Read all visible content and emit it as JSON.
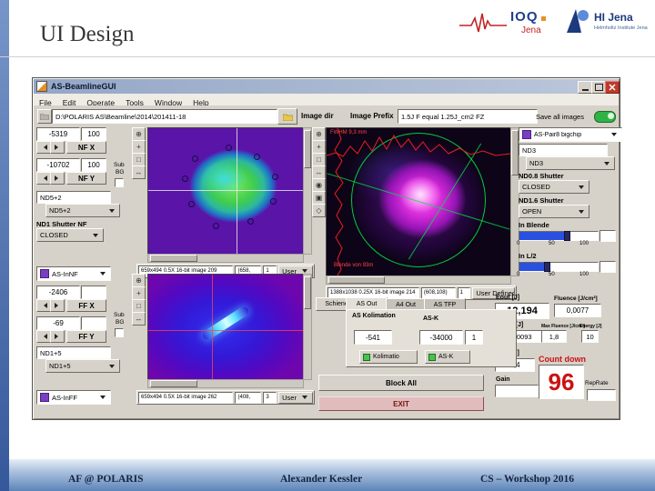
{
  "slide": {
    "title": "UI Design",
    "footer_left": "AF @ POLARIS",
    "footer_center": "Alexander Kessler",
    "footer_right": "CS – Workshop 2016"
  },
  "logos": {
    "ioq_name": "IOQ",
    "ioq_city": "Jena",
    "hi_name": "HI Jena",
    "hi_sub": "Helmholtz Institute Jena"
  },
  "window": {
    "title": "AS-BeamlineGUI",
    "menus": [
      "File",
      "Edit",
      "Operate",
      "Tools",
      "Window",
      "Help"
    ],
    "path_value": "D:\\POLARIS AS\\Beamline\\2014\\201411-18",
    "image_dir_label": "Image dir",
    "image_prefix_label": "Image Prefix",
    "image_prefix_value": "1.5J  F equal 1.25J_cm2 FZ",
    "save_all_label": "Save all images"
  },
  "icons": {
    "tools_small": [
      "⊕",
      "+",
      "□",
      "↔"
    ],
    "tools_big": [
      "⊕",
      "+",
      "□",
      "↔",
      "◉",
      "▣",
      "◇"
    ]
  },
  "nf": {
    "x_value": "-5319",
    "x_step": "100",
    "x_label": "NF X",
    "y_value": "-10702",
    "y_step": "100",
    "y_label": "NF Y",
    "nd_display": "ND5+2",
    "nd_select": "ND5+2",
    "shutter_label": "ND1 Shutter NF",
    "shutter_state": "CLOSED",
    "camera": "AS-InNF",
    "sub_label": "Sub",
    "bg_label": "BG",
    "info": "659x494 0.5X 16-bit image 209",
    "cursor": "(658,",
    "count": "1",
    "user": "User"
  },
  "ff": {
    "x_value": "-2406",
    "x_label": "FF X",
    "y_value": "-69",
    "y_label": "FF Y",
    "nd_display": "ND1+5",
    "nd_select": "ND1+5",
    "camera": "AS-InFF",
    "sub_label": "Sub",
    "bg_label": "BG",
    "info": "659x494 0.5X 16-bit image 262",
    "cursor": "(408,",
    "count": "3",
    "user": "User"
  },
  "big": {
    "info": "1388x1038 0.25X 16-bit image 214",
    "cursor": "(608,108)",
    "count": "1",
    "user": "User Defined",
    "overlay_top": "FWHM 9,3 mm",
    "overlay_bottom": "Blende von 93m"
  },
  "right": {
    "camera": "AS-Pair8 bigchip",
    "nd_display": "ND3",
    "nd_select": "ND3",
    "nd08_label": "ND0.8 Shutter",
    "nd08_state": "CLOSED",
    "nd16_label": "ND1.6 Shutter",
    "nd16_state": "OPEN",
    "blende_label": "In Blende",
    "l2_label": "In L/2",
    "ticks": [
      "0",
      "50",
      "100"
    ]
  },
  "kol": {
    "schienen": "Schienen",
    "tabs": [
      "AS Out",
      "A4 Out",
      "AS TFP"
    ],
    "kolimation_label": "AS Kolimation",
    "kol_value": "-541",
    "kol_btn": "Kolimatio",
    "ask_header": "AS-K",
    "ask_value": "-34000",
    "ask_step": "1",
    "ask_btn": "AS-K",
    "block_all": "Block All",
    "exit": "EXIT"
  },
  "readouts": {
    "eout_label": "Eout [J]",
    "eout_value": "12,194",
    "fluence_label": "Fluence [J/cm²]",
    "fluence_value": "0,0077",
    "etfp_label": "E TFP [J]",
    "etfp_value": "0,00093",
    "maxf_label": "Max Fluence [J/cm²]",
    "maxf_value": "1,8",
    "energy_label": "Energy [J]",
    "energy_value": "10",
    "ea4_label": "E A4 [J]",
    "ea4_value": "3,4",
    "gain_label": "Gain",
    "countdown_label": "Count down",
    "countdown_value": "96",
    "reprate_label": "RepRate"
  },
  "colors": {
    "accent_blue": "#4a76ad",
    "countdown_red": "#cc1111",
    "toggle_green": "#2fb346",
    "beam_purple": "#5a10a8"
  }
}
